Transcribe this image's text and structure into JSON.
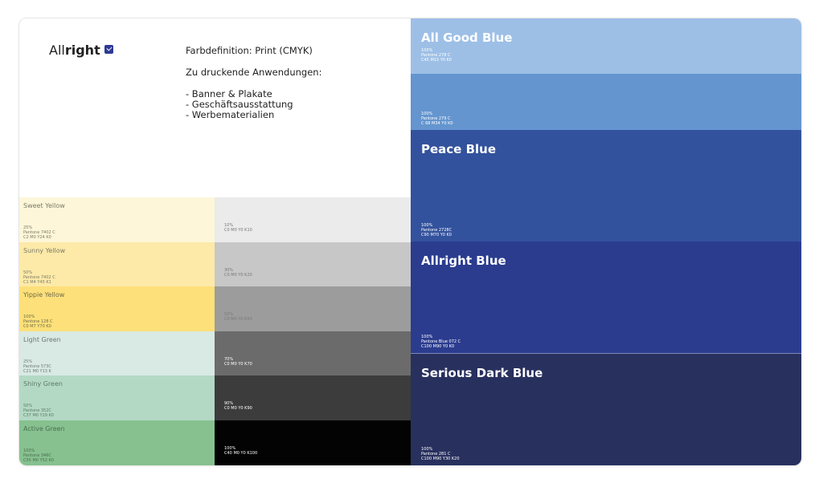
{
  "logo": {
    "light": "All",
    "bold": "right"
  },
  "intro": {
    "heading": "Farbdefinition: Print (CMYK)",
    "subheading": "Zu druckende Anwendungen:",
    "items": [
      "- Banner & Plakate",
      "- Geschäftsausstattung",
      "- Werbematerialien"
    ]
  },
  "swatches_left": [
    {
      "name": "Sweet Yellow",
      "percent": "25%",
      "pantone": "Pantone 7402 C",
      "cmyk": "C2 M0 Y24 K0",
      "color": "#fdf6d8",
      "text_color": "#7a7a6a"
    },
    {
      "name": "Sunny Yellow",
      "percent": "50%",
      "pantone": "Pantone 7402 C",
      "cmyk": "C1 M4 Y45 K1",
      "color": "#fdeaa8",
      "text_color": "#7a7a6a"
    },
    {
      "name": "Yippie Yellow",
      "percent": "100%",
      "pantone": "Pantone 128 C",
      "cmyk": "C0 M7 Y70 K0",
      "color": "#fde079",
      "text_color": "#6f6a4c"
    },
    {
      "name": "Light Green",
      "percent": "25%",
      "pantone": "Pantone 573C",
      "cmyk": "C21 M0 Y13 K",
      "color": "#d9e9e4",
      "text_color": "#6d7a74"
    },
    {
      "name": "Shiny Green",
      "percent": "50%",
      "pantone": "Pantone 352C",
      "cmyk": "C37 M0 Y29 K0",
      "color": "#b3d9c4",
      "text_color": "#5f7a6a"
    },
    {
      "name": "Active Green",
      "percent": "100%",
      "pantone": "Pantone 346C",
      "cmyk": "C55 M0 Y52 K0",
      "color": "#86c18f",
      "text_color": "#4d6f52"
    }
  ],
  "swatches_gray": [
    {
      "percent": "10%",
      "cmyk": "C0 M0 Y0 K10",
      "color": "#ebebeb",
      "text_color": "#777777"
    },
    {
      "percent": "30%",
      "cmyk": "C0 M0 Y0 K20",
      "color": "#c7c7c7",
      "text_color": "#777777"
    },
    {
      "percent": "50%",
      "cmyk": "C0 M0 Y0 K50",
      "color": "#9c9c9c",
      "text_color": "#7a7a7a"
    },
    {
      "percent": "70%",
      "cmyk": "C0 M0 Y0 K70",
      "color": "#6b6b6b",
      "text_color": "#ffffff"
    },
    {
      "percent": "90%",
      "cmyk": "C0 M0 Y0 K90",
      "color": "#3c3c3c",
      "text_color": "#ffffff"
    },
    {
      "percent": "100%",
      "cmyk": "C40 M0 Y0 K100",
      "color": "#030303",
      "text_color": "#ffffff"
    }
  ],
  "swatches_blue": [
    {
      "name": "All Good Blue",
      "percent": "100%",
      "pantone": "Pantone 278 C",
      "cmyk": "C45 M15 Y0 K0",
      "color": "#9dbfe6"
    },
    {
      "name": "",
      "percent": "100%",
      "pantone": "Pantone 279 C",
      "cmyk": "C 68 M34 Y0 K0",
      "color": "#6495cf"
    },
    {
      "name": "Peace Blue",
      "percent": "100%",
      "pantone": "Pantone 2728C",
      "cmyk": "C90 M70 Y0 K0",
      "color": "#33529d"
    },
    {
      "name": "Allright Blue",
      "percent": "100%",
      "pantone": "Pantone Blue 072 C",
      "cmyk": "C100 M90 Y0 K0",
      "color": "#2b3c8f"
    },
    {
      "name": "Serious Dark Blue",
      "percent": "100%",
      "pantone": "Pantone 281 C",
      "cmyk": "C100 M90 Y30 K20",
      "color": "#28305e"
    }
  ]
}
